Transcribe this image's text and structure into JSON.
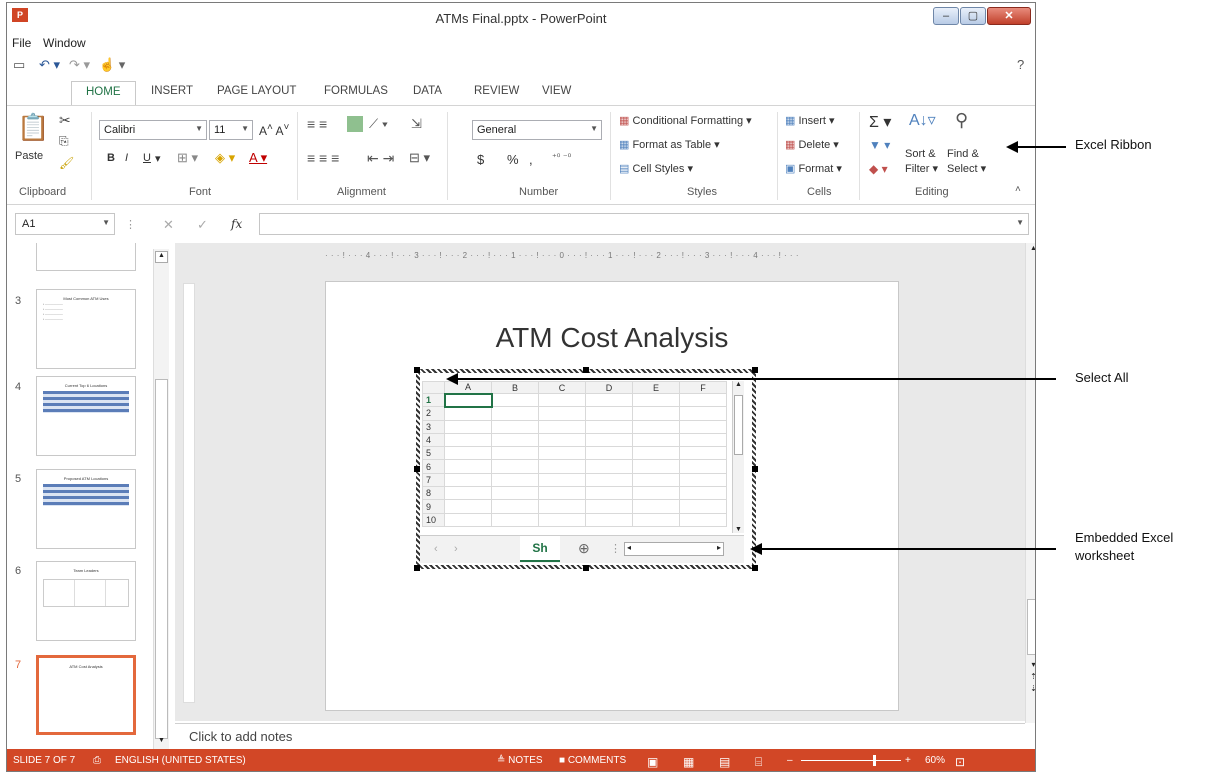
{
  "window": {
    "title": "ATMs Final.pptx - PowerPoint",
    "app_icon": "P",
    "controls": [
      "–",
      "▢",
      "✕"
    ]
  },
  "menu": [
    "File",
    "Window"
  ],
  "tabs": [
    "HOME",
    "INSERT",
    "PAGE LAYOUT",
    "FORMULAS",
    "DATA",
    "REVIEW",
    "VIEW"
  ],
  "ribbon": {
    "clipboard": {
      "paste": "Paste",
      "label": "Clipboard"
    },
    "font": {
      "name": "Calibri",
      "size": "11",
      "label": "Font",
      "bold": "B",
      "italic": "I",
      "underline": "U"
    },
    "alignment": {
      "label": "Alignment"
    },
    "number": {
      "format": "General",
      "currency": "$",
      "percent": "%",
      "comma": ",",
      "label": "Number"
    },
    "styles": {
      "conditional": "Conditional Formatting",
      "format_table": "Format as Table",
      "cell_styles": "Cell Styles",
      "label": "Styles"
    },
    "cells": {
      "insert": "Insert",
      "delete": "Delete",
      "format": "Format",
      "label": "Cells"
    },
    "editing": {
      "sort1": "Sort &",
      "sort2": "Filter",
      "find1": "Find &",
      "find2": "Select",
      "label": "Editing"
    }
  },
  "formula_bar": {
    "name_box": "A1",
    "fx": "fx"
  },
  "thumbnails": [
    {
      "num": "3",
      "title": "Most Common ATM Uses"
    },
    {
      "num": "4",
      "title": "Current Top 6 Locations"
    },
    {
      "num": "5",
      "title": "Proposed ATM Locations"
    },
    {
      "num": "6",
      "title": "Team Leaders"
    },
    {
      "num": "7",
      "title": "ATM Cost Analysis"
    }
  ],
  "slide": {
    "title": "ATM Cost Analysis",
    "ruler": "· · · ! · · · 4 · · · ! · · · 3 · · · ! · · · 2 · · · ! · · · 1 · · · ! · · · 0 · · · ! · · · 1 · · · ! · · · 2 · · · ! · · · 3 · · · ! · · · 4 · · · ! · · ·"
  },
  "worksheet": {
    "columns": [
      "A",
      "B",
      "C",
      "D",
      "E",
      "F"
    ],
    "rows": [
      "1",
      "2",
      "3",
      "4",
      "5",
      "6",
      "7",
      "8",
      "9",
      "10"
    ],
    "sheet_tab": "Sh",
    "add_sheet": "⊕"
  },
  "notes": "Click to add notes",
  "status": {
    "slide": "SLIDE 7 OF 7",
    "language": "ENGLISH (UNITED STATES)",
    "notes": "≜ NOTES",
    "comments": "■ COMMENTS",
    "zoom": "60%"
  },
  "callouts": {
    "ribbon": "Excel Ribbon",
    "select_all": "Select All",
    "embedded1": "Embedded Excel",
    "embedded2": "worksheet"
  },
  "colors": {
    "accent": "#217346",
    "status": "#d24726",
    "thumb_selected": "#e3683c"
  }
}
